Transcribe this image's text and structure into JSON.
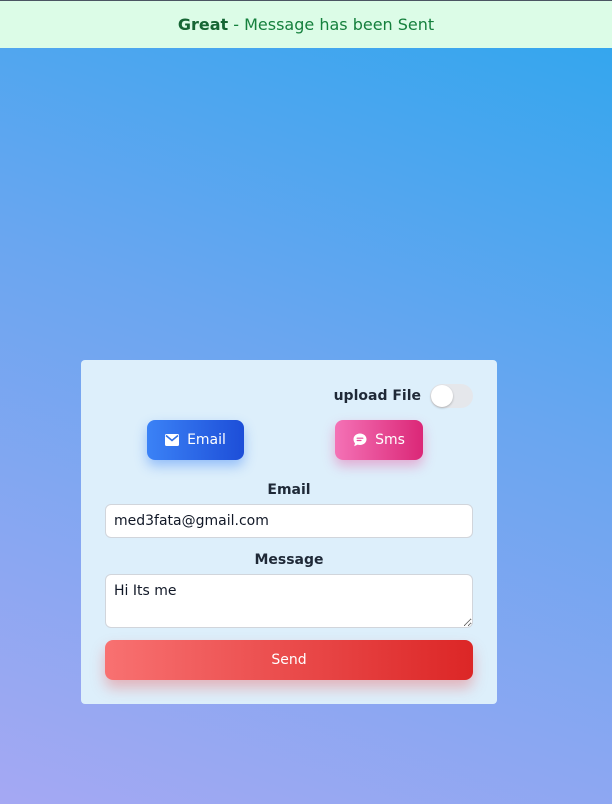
{
  "alert": {
    "title": "Great",
    "separator": " - ",
    "message": "Message has been Sent",
    "color": "#15803d",
    "background": "#dcfce7"
  },
  "form": {
    "upload_label": "upload File",
    "upload_toggle_on": false,
    "mode_buttons": {
      "email": {
        "label": "Email",
        "icon": "mail-icon",
        "color": "#2563eb"
      },
      "sms": {
        "label": "Sms",
        "icon": "chat-bubble-icon",
        "color": "#ec4899"
      }
    },
    "email_label": "Email",
    "email_value": "med3fata@gmail.com",
    "message_label": "Message",
    "message_value": "Hi Its me",
    "send_label": "Send",
    "send_color": "#ef4444"
  }
}
